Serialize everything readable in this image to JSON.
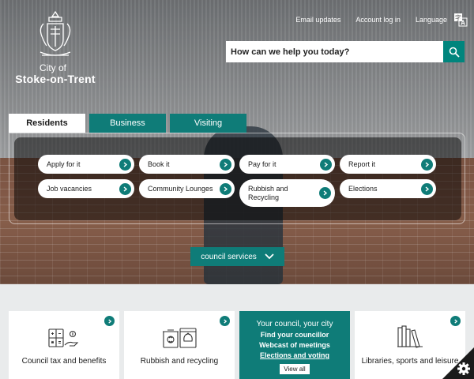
{
  "header": {
    "logo": {
      "line1": "City of",
      "line2": "Stoke-on-Trent"
    },
    "links": [
      {
        "label": "Email updates"
      },
      {
        "label": "Account log in"
      },
      {
        "label": "Language"
      }
    ]
  },
  "search": {
    "placeholder": "How can we help you today?",
    "icon": "search-icon"
  },
  "tabs": [
    {
      "label": "Residents",
      "active": true
    },
    {
      "label": "Business",
      "active": false
    },
    {
      "label": "Visiting",
      "active": false
    }
  ],
  "quick_links": [
    {
      "label": "Apply for it"
    },
    {
      "label": "Book it"
    },
    {
      "label": "Pay for it"
    },
    {
      "label": "Report it"
    },
    {
      "label": "Job vacancies"
    },
    {
      "label": "Community Lounges"
    },
    {
      "label": "Rubbish and Recycling"
    },
    {
      "label": "Elections"
    }
  ],
  "council_services_button": {
    "label": "council services"
  },
  "cards": [
    {
      "title": "Council tax and benefits",
      "icon": "calculator-money-icon"
    },
    {
      "title": "Rubbish and recycling",
      "icon": "bins-icon"
    },
    {
      "title": "Libraries, sports and leisure",
      "icon": "books-icon"
    }
  ],
  "council_card": {
    "title": "Your council, your city",
    "links": [
      "Find your councillor",
      "Webcast of meetings",
      "Elections and voting"
    ],
    "view_all": "View all"
  },
  "colors": {
    "brand_teal": "#0f7c78",
    "search_button": "#00857d"
  }
}
